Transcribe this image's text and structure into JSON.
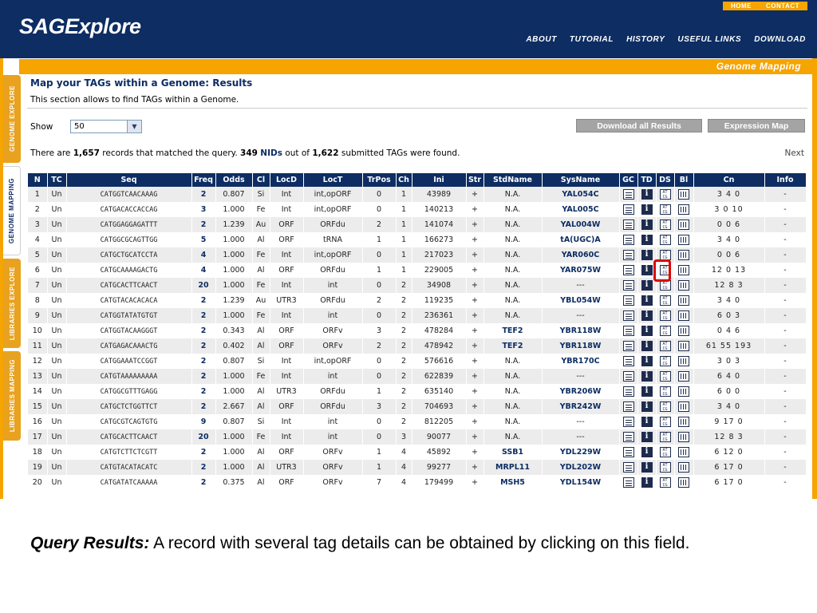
{
  "app": {
    "logo": "SAGExplore",
    "top_links": [
      "HOME",
      "CONTACT"
    ],
    "nav": [
      "ABOUT",
      "TUTORIAL",
      "HISTORY",
      "USEFUL LINKS",
      "DOWNLOAD"
    ],
    "section_banner": "Genome Mapping",
    "side_tabs": [
      "GENOME EXPLORE",
      "GENOME MAPPING",
      "LIBRARIES EXPLORE",
      "LIBRARIES MAPPING"
    ]
  },
  "page": {
    "title": "Map your TAGs within a Genome: Results",
    "subtitle": "This section allows to find TAGs within a Genome.",
    "show_label": "Show",
    "show_value": "50",
    "download_button": "Download all Results",
    "expression_button": "Expression Map",
    "summary": {
      "prefix": "There are ",
      "records": "1,657",
      "middle": " records that matched the query. ",
      "nids": "349",
      "nids_label": "NIDs",
      "out_of": " out of ",
      "submitted": "1,622",
      "suffix": " submitted TAGs were found."
    },
    "next": "Next"
  },
  "table": {
    "columns": [
      "N",
      "TC",
      "Seq",
      "Freq",
      "Odds",
      "Cl",
      "LocD",
      "LocT",
      "TrPos",
      "Ch",
      "Ini",
      "Str",
      "StdName",
      "SysName",
      "GC",
      "TD",
      "DS",
      "Bl",
      "Cn",
      "Info"
    ],
    "rows": [
      [
        "1",
        "Un",
        "CATGGTCAACAAAG",
        "2",
        "0.807",
        "Si",
        "Int",
        "int,opORF",
        "0",
        "1",
        "43989",
        "+",
        "N.A.",
        "YAL054C",
        "3 4 0",
        "-"
      ],
      [
        "2",
        "Un",
        "CATGACACCACCAG",
        "3",
        "1.000",
        "Fe",
        "Int",
        "int,opORF",
        "0",
        "1",
        "140213",
        "+",
        "N.A.",
        "YAL005C",
        "3 0 10",
        "-"
      ],
      [
        "3",
        "Un",
        "CATGGAGGAGATTT",
        "2",
        "1.239",
        "Au",
        "ORF",
        "ORFdu",
        "2",
        "1",
        "141074",
        "+",
        "N.A.",
        "YAL004W",
        "0 0 6",
        "-"
      ],
      [
        "4",
        "Un",
        "CATGGCGCAGTTGG",
        "5",
        "1.000",
        "Al",
        "ORF",
        "tRNA",
        "1",
        "1",
        "166273",
        "+",
        "N.A.",
        "tA(UGC)A",
        "3 4 0",
        "-"
      ],
      [
        "5",
        "Un",
        "CATGCTGCATCCTA",
        "4",
        "1.000",
        "Fe",
        "Int",
        "int,opORF",
        "0",
        "1",
        "217023",
        "+",
        "N.A.",
        "YAR060C",
        "0 0 6",
        "-"
      ],
      [
        "6",
        "Un",
        "CATGCAAAAGACTG",
        "4",
        "1.000",
        "Al",
        "ORF",
        "ORFdu",
        "1",
        "1",
        "229005",
        "+",
        "N.A.",
        "YAR075W",
        "12 0 13",
        "-"
      ],
      [
        "7",
        "Un",
        "CATGCACTTCAACT",
        "20",
        "1.000",
        "Fe",
        "Int",
        "int",
        "0",
        "2",
        "34908",
        "+",
        "N.A.",
        "---",
        "12 8 3",
        "-"
      ],
      [
        "8",
        "Un",
        "CATGTACACACACA",
        "2",
        "1.239",
        "Au",
        "UTR3",
        "ORFdu",
        "2",
        "2",
        "119235",
        "+",
        "N.A.",
        "YBL054W",
        "3 4 0",
        "-"
      ],
      [
        "9",
        "Un",
        "CATGGTATATGTGT",
        "2",
        "1.000",
        "Fe",
        "Int",
        "int",
        "0",
        "2",
        "236361",
        "+",
        "N.A.",
        "---",
        "6 0 3",
        "-"
      ],
      [
        "10",
        "Un",
        "CATGGTACAAGGGT",
        "2",
        "0.343",
        "Al",
        "ORF",
        "ORFv",
        "3",
        "2",
        "478284",
        "+",
        "TEF2",
        "YBR118W",
        "0 4 6",
        "-"
      ],
      [
        "11",
        "Un",
        "CATGAGACAAACTG",
        "2",
        "0.402",
        "Al",
        "ORF",
        "ORFv",
        "2",
        "2",
        "478942",
        "+",
        "TEF2",
        "YBR118W",
        "61 55 193",
        "-"
      ],
      [
        "12",
        "Un",
        "CATGGAAATCCGGT",
        "2",
        "0.807",
        "Si",
        "Int",
        "int,opORF",
        "0",
        "2",
        "576616",
        "+",
        "N.A.",
        "YBR170C",
        "3 0 3",
        "-"
      ],
      [
        "13",
        "Un",
        "CATGTAAAAAAAAA",
        "2",
        "1.000",
        "Fe",
        "Int",
        "int",
        "0",
        "2",
        "622839",
        "+",
        "N.A.",
        "---",
        "6 4 0",
        "-"
      ],
      [
        "14",
        "Un",
        "CATGGCGTTTGAGG",
        "2",
        "1.000",
        "Al",
        "UTR3",
        "ORFdu",
        "1",
        "2",
        "635140",
        "+",
        "N.A.",
        "YBR206W",
        "6 0 0",
        "-"
      ],
      [
        "15",
        "Un",
        "CATGCTCTGGTTCT",
        "2",
        "2.667",
        "Al",
        "ORF",
        "ORFdu",
        "3",
        "2",
        "704693",
        "+",
        "N.A.",
        "YBR242W",
        "3 4 0",
        "-"
      ],
      [
        "16",
        "Un",
        "CATGCGTCAGTGTG",
        "9",
        "0.807",
        "Si",
        "Int",
        "int",
        "0",
        "2",
        "812205",
        "+",
        "N.A.",
        "---",
        "9 17 0",
        "-"
      ],
      [
        "17",
        "Un",
        "CATGCACTTCAACT",
        "20",
        "1.000",
        "Fe",
        "Int",
        "int",
        "0",
        "3",
        "90077",
        "+",
        "N.A.",
        "---",
        "12 8 3",
        "-"
      ],
      [
        "18",
        "Un",
        "CATGTCTTCTCGTT",
        "2",
        "1.000",
        "Al",
        "ORF",
        "ORFv",
        "1",
        "4",
        "45892",
        "+",
        "SSB1",
        "YDL229W",
        "6 12 0",
        "-"
      ],
      [
        "19",
        "Un",
        "CATGTACATACATC",
        "2",
        "1.000",
        "Al",
        "UTR3",
        "ORFv",
        "1",
        "4",
        "99277",
        "+",
        "MRPL11",
        "YDL202W",
        "6 17 0",
        "-"
      ],
      [
        "20",
        "Un",
        "CATGATATCAAAAA",
        "2",
        "0.375",
        "Al",
        "ORF",
        "ORFv",
        "7",
        "4",
        "179499",
        "+",
        "MSH5",
        "YDL154W",
        "6 17 0",
        "-"
      ]
    ]
  },
  "caption": {
    "lead": "Query Results:",
    "text": " A record with several tag details can be obtained by clicking on this field."
  }
}
